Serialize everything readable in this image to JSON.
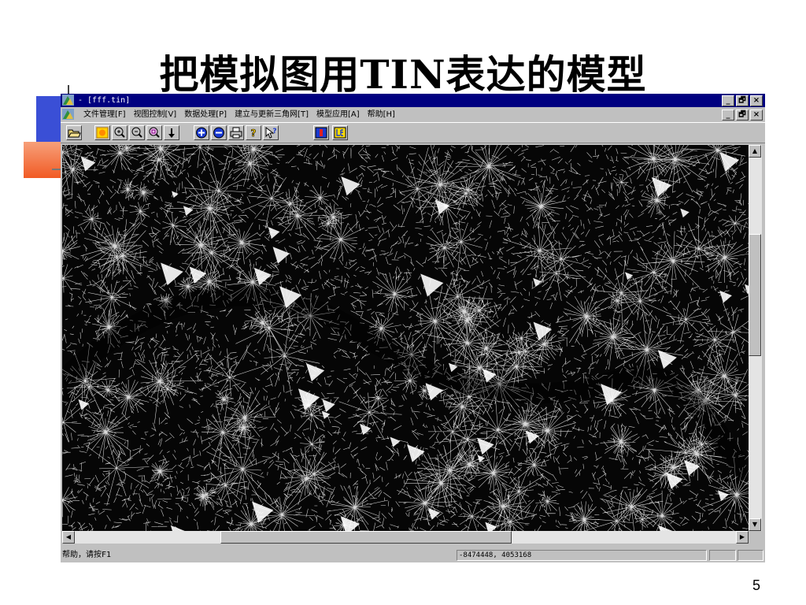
{
  "slide": {
    "title": "把模拟图用TIN表达的模型",
    "page_number": "5"
  },
  "window": {
    "title": "- [fff.tin]",
    "controls": [
      "_",
      "🗗",
      "×"
    ]
  },
  "menu": {
    "items": [
      "文件管理[F]",
      "视图控制[V]",
      "数据处理[P]",
      "建立与更新三角网[T]",
      "模型应用[A]",
      "帮助[H]"
    ],
    "controls": [
      "_",
      "🗗",
      "×"
    ]
  },
  "toolbar": {
    "buttons": [
      "open-file-icon",
      "zoom-extent-icon",
      "zoom-in-icon",
      "zoom-out-icon",
      "zoom-window-icon",
      "down-arrow-icon",
      "add-point-icon",
      "remove-point-icon",
      "print-icon",
      "help-icon",
      "context-help-icon",
      "red-tool-icon",
      "le-tool-icon"
    ]
  },
  "scrollbars": {
    "up": "▲",
    "down": "▼",
    "left": "◀",
    "right": "▶"
  },
  "statusbar": {
    "help_text": "帮助，请按F1",
    "coordinates": "-8474448, 4053168"
  },
  "colors": {
    "title_bar": "#000080",
    "window_face": "#c0c0c0",
    "accent_blue": "#3a4fd6",
    "accent_orange": "#f15a24"
  }
}
